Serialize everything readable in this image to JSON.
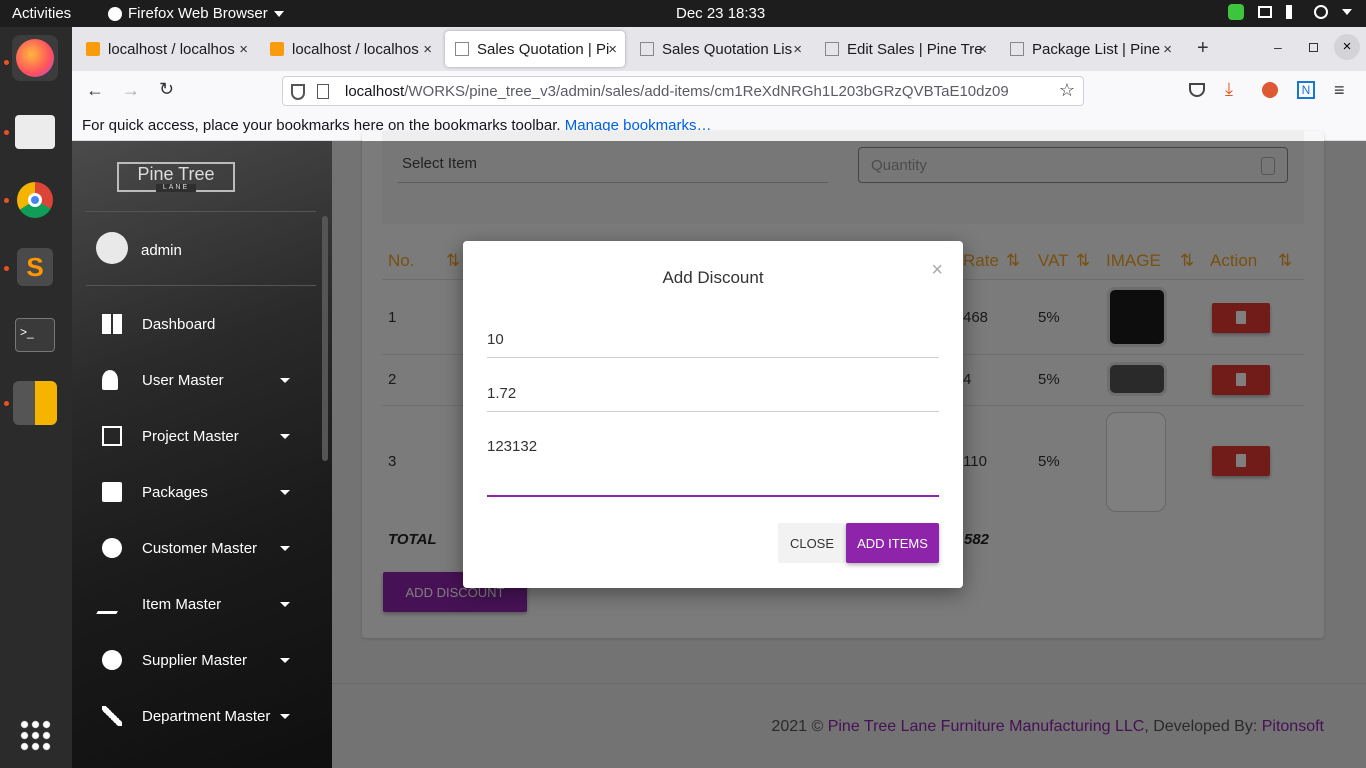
{
  "system": {
    "activities": "Activities",
    "app_name": "Firefox Web Browser",
    "clock": "Dec 23  18:33"
  },
  "tabs": [
    {
      "label": "localhost / localhos",
      "active": false
    },
    {
      "label": "localhost / localhos",
      "active": false
    },
    {
      "label": "Sales Quotation | Pi",
      "active": true
    },
    {
      "label": "Sales Quotation Lis",
      "active": false
    },
    {
      "label": "Edit Sales | Pine Tre",
      "active": false
    },
    {
      "label": "Package List | Pine",
      "active": false
    }
  ],
  "url": {
    "host": "localhost",
    "path": "/WORKS/pine_tree_v3/admin/sales/add-items/cm1ReXdNRGh1L203bGRzQVBTaE10dz09"
  },
  "bookmarks": {
    "text": "For quick access, place your bookmarks here on the bookmarks toolbar.",
    "link": "Manage bookmarks…"
  },
  "sidebar": {
    "logo": "Pine Tree",
    "logo_sub": "LANE",
    "username": "admin",
    "items": [
      {
        "label": "Dashboard"
      },
      {
        "label": "User Master"
      },
      {
        "label": "Project Master"
      },
      {
        "label": "Packages"
      },
      {
        "label": "Customer Master"
      },
      {
        "label": "Item Master"
      },
      {
        "label": "Supplier Master"
      },
      {
        "label": "Department Master"
      }
    ]
  },
  "form": {
    "select_item": "Select Item",
    "quantity_placeholder": "Quantity"
  },
  "table": {
    "headers": {
      "no": "No.",
      "rate": "Rate",
      "vat": "VAT",
      "image": "IMAGE",
      "action": "Action"
    },
    "rows": [
      {
        "no": "1",
        "rate": "468",
        "vat": "5%"
      },
      {
        "no": "2",
        "rate": "4",
        "vat": "5%"
      },
      {
        "no": "3",
        "rate": "110",
        "vat": "5%"
      }
    ],
    "total_label": "TOTAL",
    "total_value": "582",
    "add_discount": "ADD DISCOUNT"
  },
  "modal": {
    "title": "Add Discount",
    "close_x": "×",
    "field1": "10",
    "field2": "1.72",
    "field3": "123132",
    "close_btn": "CLOSE",
    "add_btn": "ADD ITEMS"
  },
  "footer": {
    "prefix": "2021 © ",
    "company": "Pine Tree Lane Furniture Manufacturing LLC",
    "mid": ", Developed By: ",
    "dev": "Pitonsoft"
  },
  "colors": {
    "accent": "#8e24aa",
    "danger": "#e53935",
    "header": "#f0a020"
  }
}
